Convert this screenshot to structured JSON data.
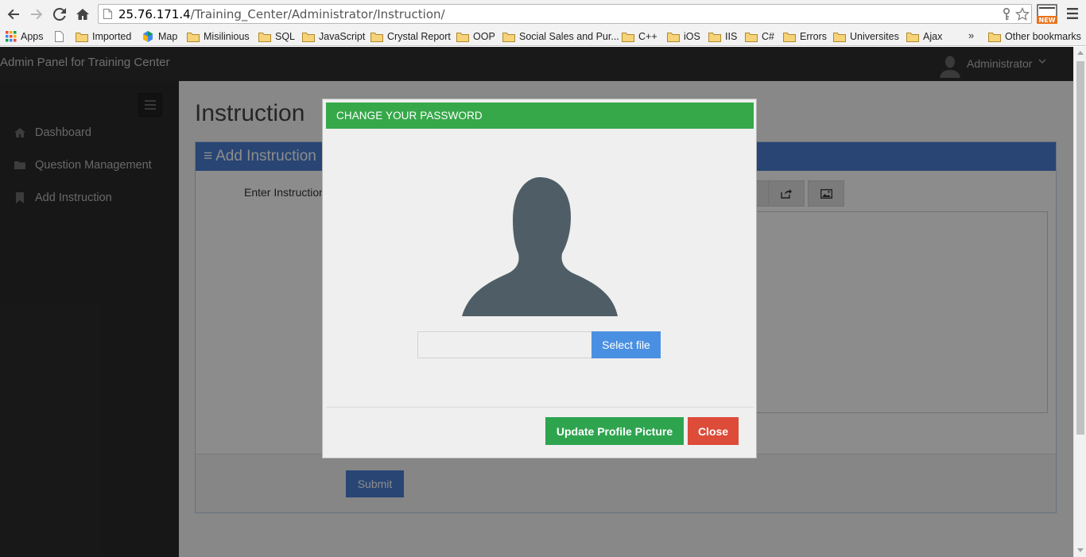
{
  "browser": {
    "url_host": "25.76.171.4",
    "url_path": "/Training_Center/Administrator/Instruction/",
    "bookmarks": [
      {
        "label": "Apps",
        "icon": "apps-grid-icon"
      },
      {
        "label": "",
        "icon": "page-icon"
      },
      {
        "label": "Imported",
        "icon": "folder-icon"
      },
      {
        "label": "Map",
        "icon": "maps-icon"
      },
      {
        "label": "Misilinious",
        "icon": "folder-icon"
      },
      {
        "label": "SQL",
        "icon": "folder-icon"
      },
      {
        "label": "JavaScript",
        "icon": "folder-icon"
      },
      {
        "label": "Crystal Report",
        "icon": "folder-icon"
      },
      {
        "label": "OOP",
        "icon": "folder-icon"
      },
      {
        "label": "Social Sales and Pur...",
        "icon": "folder-icon"
      },
      {
        "label": "C++",
        "icon": "folder-icon"
      },
      {
        "label": "iOS",
        "icon": "folder-icon"
      },
      {
        "label": "IIS",
        "icon": "folder-icon"
      },
      {
        "label": "C#",
        "icon": "folder-icon"
      },
      {
        "label": "Errors",
        "icon": "folder-icon"
      },
      {
        "label": "Universites",
        "icon": "folder-icon"
      },
      {
        "label": "Ajax",
        "icon": "folder-icon"
      }
    ],
    "overflow": "»",
    "other_bookmarks": "Other bookmarks"
  },
  "app": {
    "brand": "Admin Panel for Training Center",
    "user": "Administrator"
  },
  "sidebar": {
    "items": [
      {
        "label": "Dashboard",
        "icon": "home-icon"
      },
      {
        "label": "Question Management",
        "icon": "folder-icon"
      },
      {
        "label": "Add Instruction",
        "icon": "bookmark-icon"
      }
    ]
  },
  "main": {
    "page_title": "Instruction",
    "panel_title": "Add Instruction",
    "field_label": "Enter Instruction",
    "submit_label": "Submit"
  },
  "modal": {
    "title": "CHANGE YOUR PASSWORD",
    "select_file_label": "Select file",
    "file_value": "",
    "update_label": "Update Profile Picture",
    "close_label": "Close"
  },
  "colors": {
    "modal_header": "#36a84a",
    "primary": "#4a7fd4",
    "success_button": "#2ea44f",
    "danger_button": "#dd4b39"
  }
}
